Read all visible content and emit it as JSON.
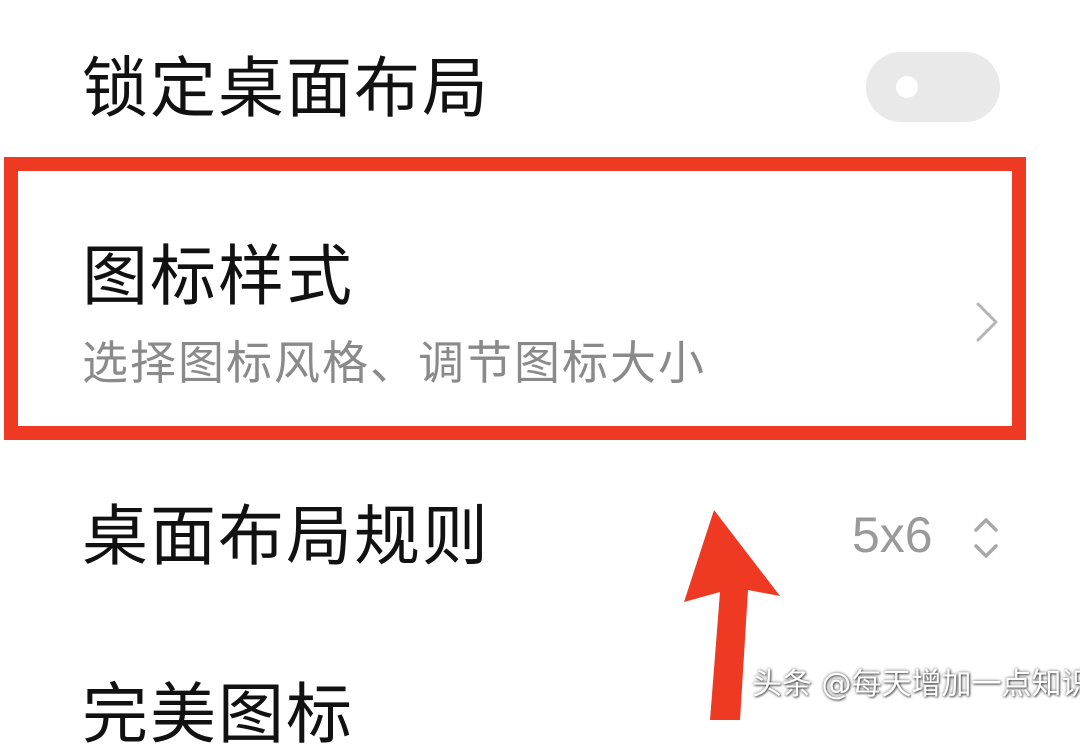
{
  "settings": {
    "lock_layout": {
      "label": "锁定桌面布局",
      "enabled": false
    },
    "icon_style": {
      "label": "图标样式",
      "description": "选择图标风格、调节图标大小"
    },
    "layout_rules": {
      "label": "桌面布局规则",
      "value": "5x6"
    },
    "partial_item": {
      "label": "完美图标"
    }
  },
  "icons": {
    "toggle": "toggle-switch",
    "chevron": "chevron-right-icon",
    "updown": "up-down-chevron-icon",
    "annotation_arrow": "arrow-up-icon"
  },
  "colors": {
    "highlight": "#ee3a22",
    "text_primary": "#111111",
    "text_secondary": "#8a8a8a",
    "toggle_off": "#e9e9e9"
  },
  "watermark": "头条 @每天增加一点知识"
}
